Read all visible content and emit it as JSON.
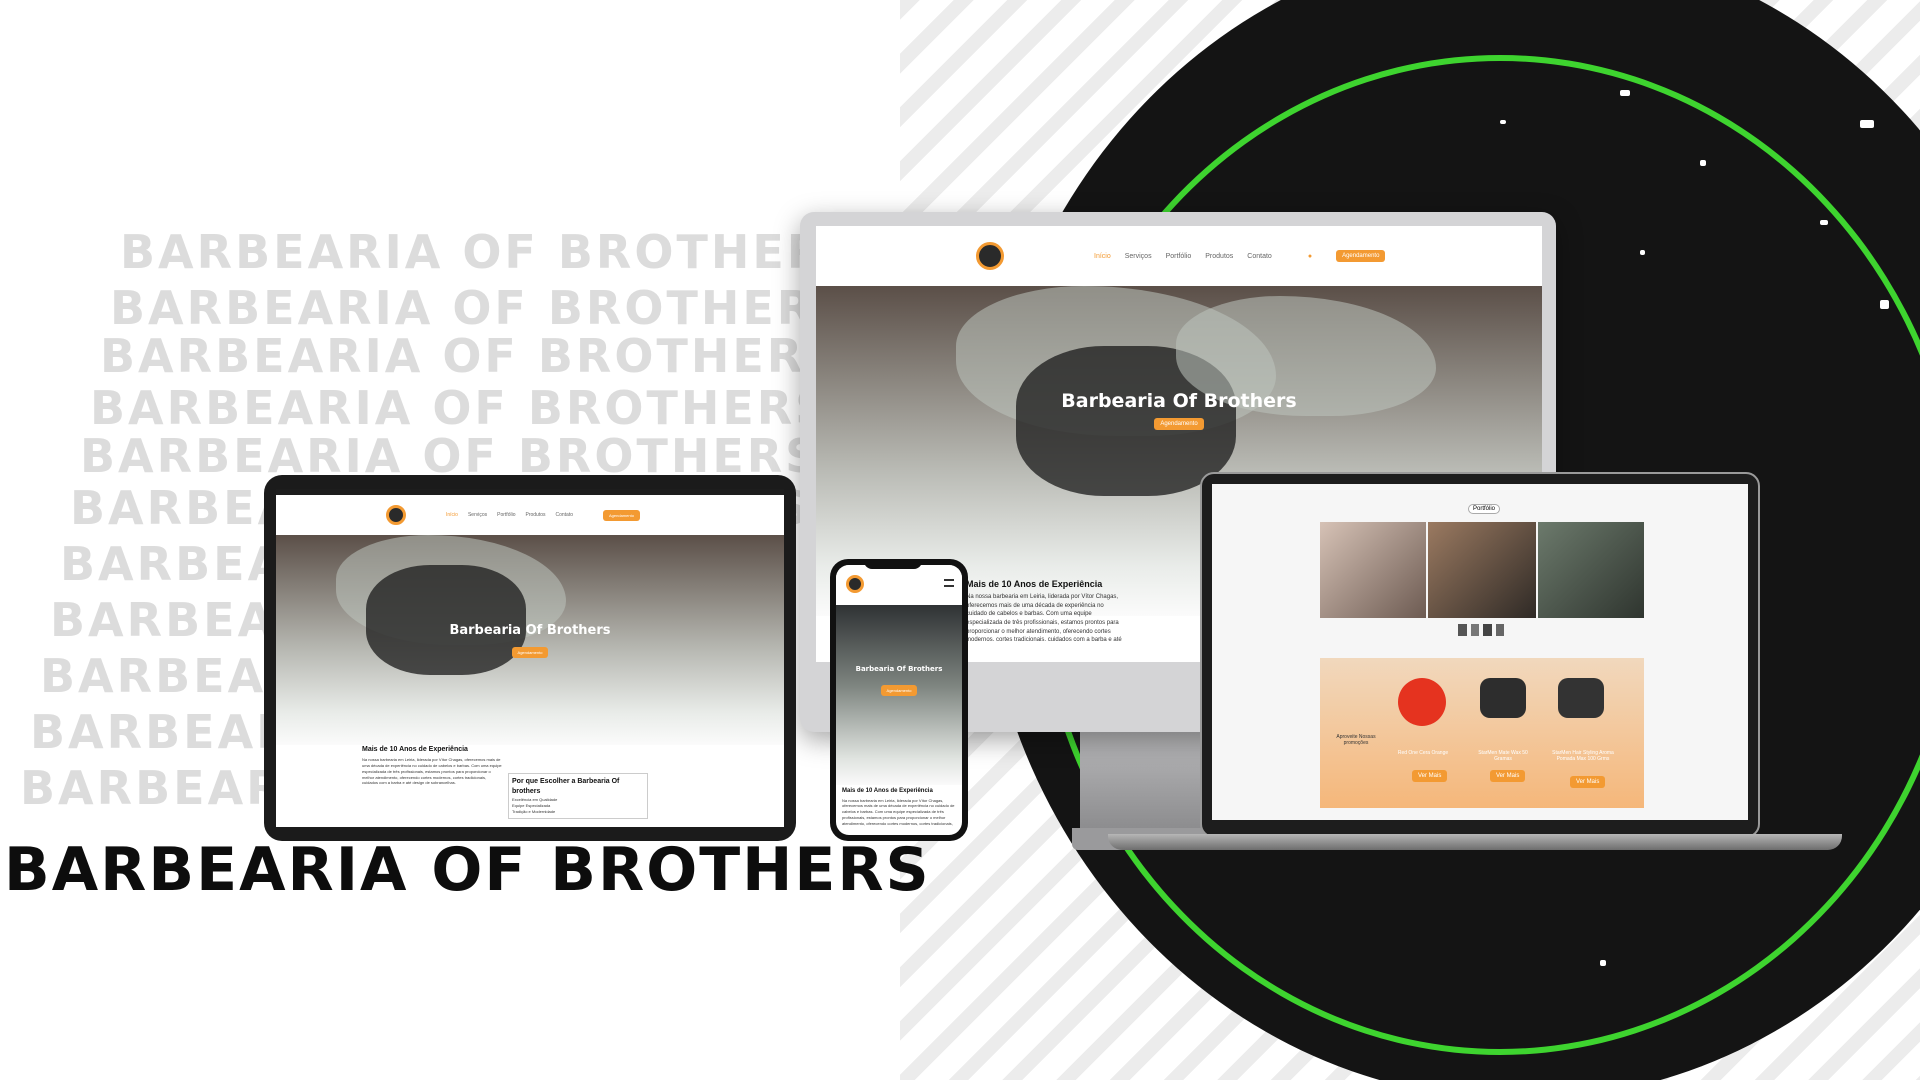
{
  "brand_title": "BARBEARIA OF BROTHERS",
  "ghost_text": [
    "BARBEARIA OF BROTHERS",
    "BARBEARIA OF BROTHERS",
    "BARBEARIA OF BROTHERS",
    "BARBEARIA OF BROTHERS",
    "BARBEARIA OF BROTHERS",
    "BARBEARIA OF BROTHERS",
    "BARBEARIA OF BROTHERS",
    "BARBEARIA OF BROTHERS",
    "BARBEARIA OF BROTHERS",
    "BARBEARIA OF BROTHERS",
    "BARBEARIA OF BROTHERS"
  ],
  "colors": {
    "accent": "#f39a32",
    "ring": "#3ed42f",
    "blob": "#141414"
  },
  "site": {
    "nav": {
      "items": [
        "Início",
        "Serviços",
        "Portfólio",
        "Produtos",
        "Contato"
      ],
      "cta": "Agendamento"
    },
    "hero": {
      "title": "Barbearia Of Brothers",
      "button": "Agendamento"
    },
    "about": {
      "heading": "Mais de 10 Anos de Experiência",
      "paragraph": "Na nossa barbearia em Leiria, liderada por Vítor Chagas, oferecemos mais de uma década de experiência no cuidado de cabelos e barbas. Com uma equipe especializada de três profissionais, estamos prontos para proporcionar o melhor atendimento, oferecendo cortes modernos, cortes tradicionais, cuidados com a barba e até design de sobrancelhas."
    },
    "why": {
      "heading": "Por que Escolher a Barbearia Of brothers",
      "items": [
        "Excelência em Qualidade",
        "Equipe Especializada",
        "Tradição e Modernidade"
      ]
    },
    "portfolio_badge": "Portfólio",
    "promo": {
      "label": "Aproveite Nossas promoções",
      "products": [
        {
          "name": "Red One Cera Orange",
          "button": "Ver Mais"
        },
        {
          "name": "StarMen Mate Wax 50 Gramas",
          "button": "Ver Mais"
        },
        {
          "name": "StarMen Hair Styling Aroma Pomada Max 100 Grms",
          "button": "Ver Mais"
        }
      ]
    }
  }
}
